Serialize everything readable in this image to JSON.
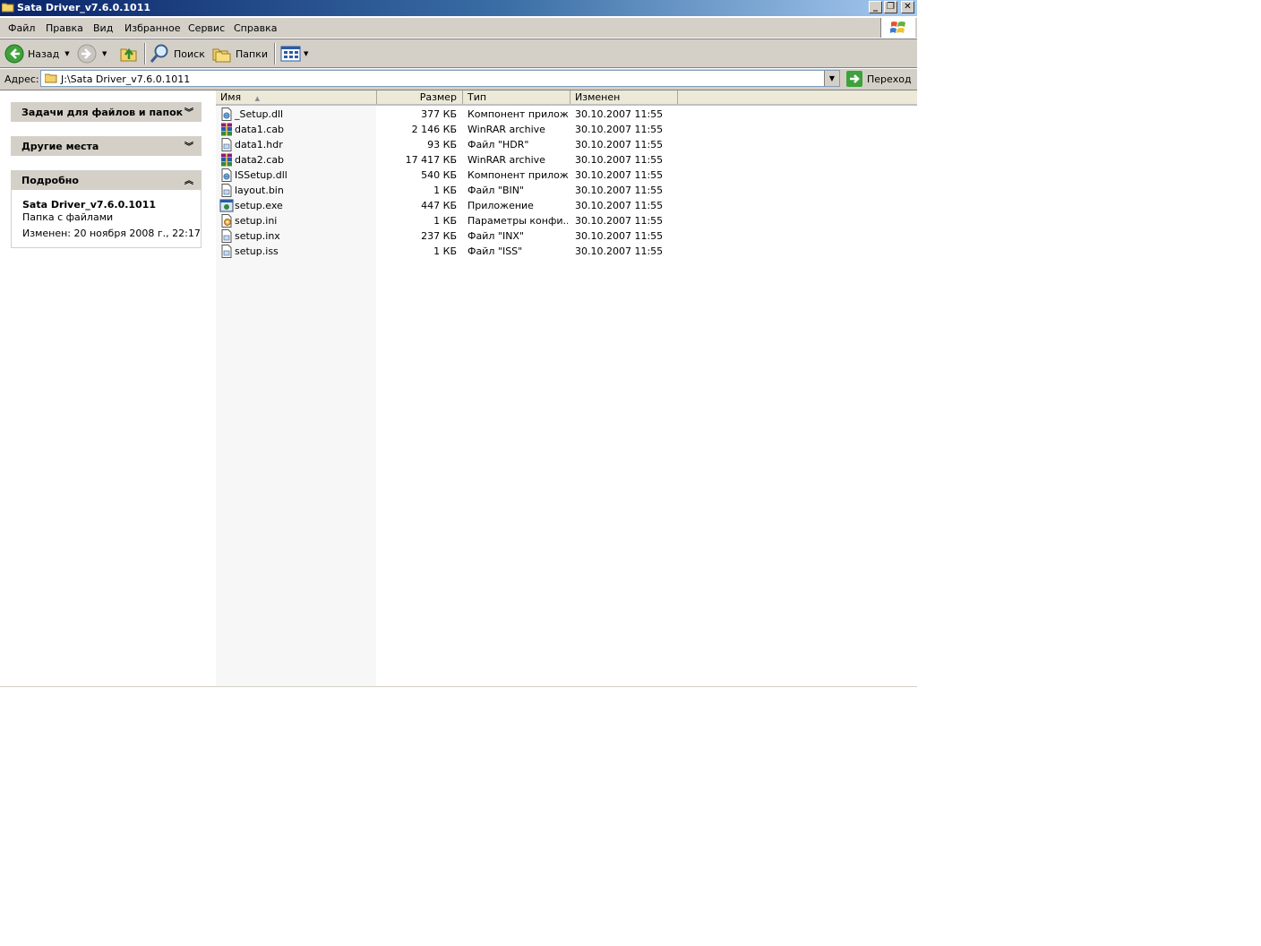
{
  "window": {
    "title": "Sata Driver_v7.6.0.1011"
  },
  "menubar": {
    "items": [
      "Файл",
      "Правка",
      "Вид",
      "Избранное",
      "Сервис",
      "Справка"
    ]
  },
  "toolbar": {
    "back_label": "Назад",
    "search_label": "Поиск",
    "folders_label": "Папки"
  },
  "address": {
    "label": "Адрес:",
    "value": "J:\\Sata Driver_v7.6.0.1011",
    "go_label": "Переход"
  },
  "leftpane": {
    "tasks_title": "Задачи для файлов и папок",
    "other_places_title": "Другие места",
    "details_title": "Подробно",
    "details": {
      "name": "Sata Driver_v7.6.0.1011",
      "kind": "Папка с файлами",
      "modified": "Изменен: 20 ноября 2008 г., 22:17"
    }
  },
  "list": {
    "columns": {
      "name": "Имя",
      "size": "Размер",
      "type": "Тип",
      "modified": "Изменен"
    },
    "rows": [
      {
        "name": "_Setup.dll",
        "size": "377 КБ",
        "type": "Компонент прилож...",
        "date": "30.10.2007 11:55",
        "icon": "dll-icon"
      },
      {
        "name": "data1.cab",
        "size": "2 146 КБ",
        "type": "WinRAR archive",
        "date": "30.10.2007 11:55",
        "icon": "winrar-icon"
      },
      {
        "name": "data1.hdr",
        "size": "93 КБ",
        "type": "Файл \"HDR\"",
        "date": "30.10.2007 11:55",
        "icon": "generic-file-icon"
      },
      {
        "name": "data2.cab",
        "size": "17 417 КБ",
        "type": "WinRAR archive",
        "date": "30.10.2007 11:55",
        "icon": "winrar-icon"
      },
      {
        "name": "ISSetup.dll",
        "size": "540 КБ",
        "type": "Компонент прилож...",
        "date": "30.10.2007 11:55",
        "icon": "dll-icon"
      },
      {
        "name": "layout.bin",
        "size": "1 КБ",
        "type": "Файл \"BIN\"",
        "date": "30.10.2007 11:55",
        "icon": "generic-file-icon"
      },
      {
        "name": "setup.exe",
        "size": "447 КБ",
        "type": "Приложение",
        "date": "30.10.2007 11:55",
        "icon": "exe-icon"
      },
      {
        "name": "setup.ini",
        "size": "1 КБ",
        "type": "Параметры конфи...",
        "date": "30.10.2007 11:55",
        "icon": "ini-icon"
      },
      {
        "name": "setup.inx",
        "size": "237 КБ",
        "type": "Файл \"INX\"",
        "date": "30.10.2007 11:55",
        "icon": "generic-file-icon"
      },
      {
        "name": "setup.iss",
        "size": "1 КБ",
        "type": "Файл \"ISS\"",
        "date": "30.10.2007 11:55",
        "icon": "generic-file-icon"
      }
    ]
  }
}
